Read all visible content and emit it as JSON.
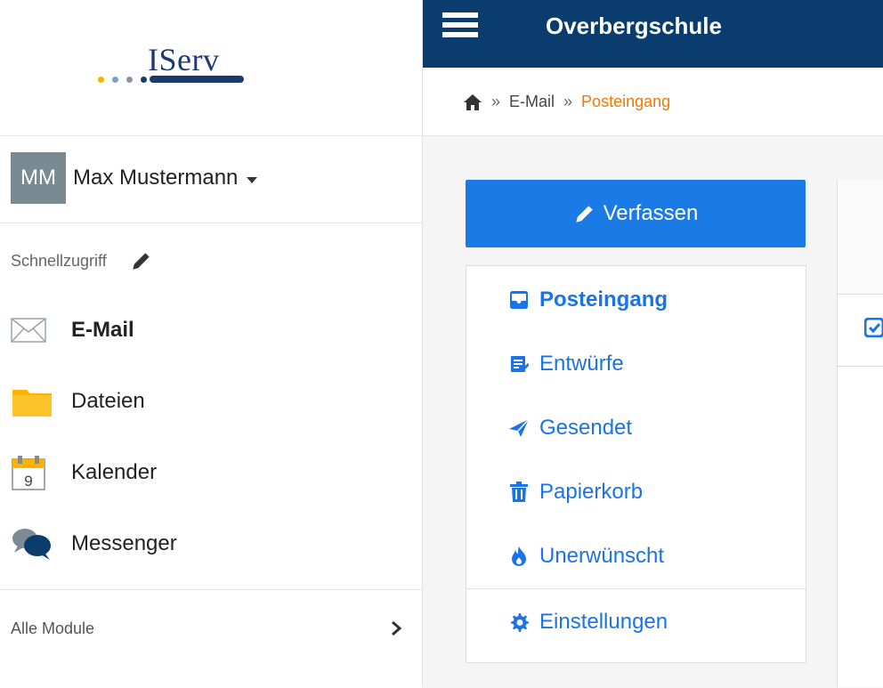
{
  "brand": {
    "logo_text": "IServ"
  },
  "header": {
    "school_name": "Overbergschule"
  },
  "user": {
    "initials": "MM",
    "name": "Max Mustermann"
  },
  "quick_access": {
    "label": "Schnellzugriff"
  },
  "sidebar": {
    "items": [
      {
        "label": "E-Mail",
        "icon": "envelope-icon",
        "active": true
      },
      {
        "label": "Dateien",
        "icon": "folder-icon"
      },
      {
        "label": "Kalender",
        "icon": "calendar-icon",
        "icon_text": "9"
      },
      {
        "label": "Messenger",
        "icon": "chat-icon"
      }
    ],
    "all_modules": "Alle Module"
  },
  "breadcrumb": {
    "sep": "»",
    "items": [
      "E-Mail",
      "Posteingang"
    ]
  },
  "mail": {
    "compose_label": "Verfassen",
    "folders": [
      {
        "label": "Posteingang",
        "icon": "inbox-icon",
        "active": true
      },
      {
        "label": "Entwürfe",
        "icon": "drafts-icon"
      },
      {
        "label": "Gesendet",
        "icon": "sent-icon"
      },
      {
        "label": "Papierkorb",
        "icon": "trash-icon"
      },
      {
        "label": "Unerwünscht",
        "icon": "spam-icon"
      }
    ],
    "settings_label": "Einstellungen"
  },
  "colors": {
    "header_bg": "#0b3c6e",
    "accent": "#1a7ae6",
    "breadcrumb_current": "#f07800",
    "link": "#1a73e8"
  }
}
